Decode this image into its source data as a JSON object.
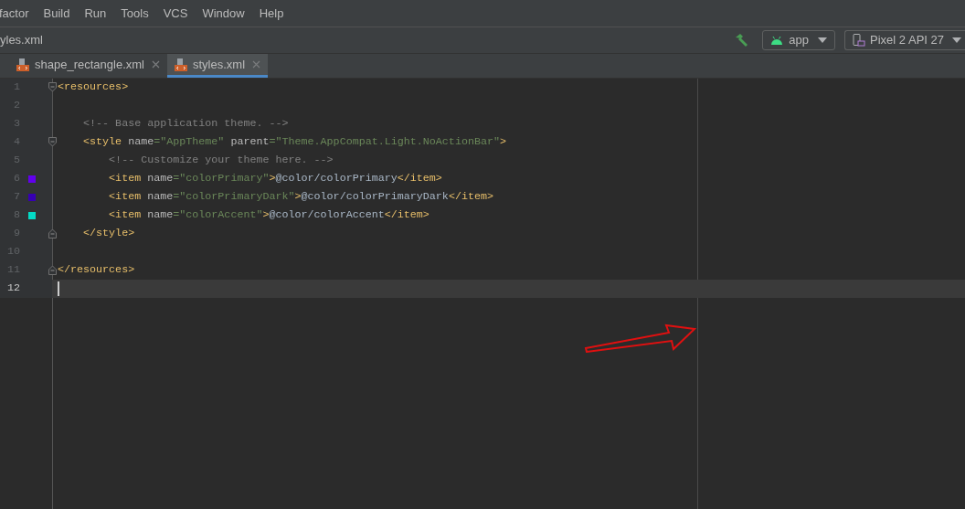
{
  "menu": [
    "factor",
    "Build",
    "Run",
    "Tools",
    "VCS",
    "Window",
    "Help"
  ],
  "breadcrumb": "yles.xml",
  "toolbar": {
    "config": "app",
    "device": "Pixel 2 API 27"
  },
  "tabs": [
    {
      "label": "shape_rectangle.xml",
      "selected": false
    },
    {
      "label": "styles.xml",
      "selected": true
    }
  ],
  "lines": [
    {
      "number": "1",
      "fold_start": true,
      "current": false,
      "tokens": [
        {
          "kind": "tag",
          "text": "<resources>"
        }
      ]
    },
    {
      "number": "2",
      "current": false
    },
    {
      "number": "3",
      "current": false,
      "tokens": [
        {
          "kind": "comment",
          "text": "    <!-- Base application theme. -->"
        }
      ]
    },
    {
      "number": "4",
      "fold_start": true,
      "current": false,
      "tokens": [
        {
          "kind": "tag",
          "text": "    <style "
        },
        {
          "kind": "attr",
          "text": "name"
        },
        {
          "kind": "value",
          "text": "=\"AppTheme\" "
        },
        {
          "kind": "attr",
          "text": "parent"
        },
        {
          "kind": "value",
          "text": "=\"Theme.AppCompat.Light.NoActionBar\""
        },
        {
          "kind": "tag",
          "text": ">"
        }
      ]
    },
    {
      "number": "5",
      "current": false,
      "tokens": [
        {
          "kind": "comment",
          "text": "        <!-- Customize your theme here. -->"
        }
      ]
    },
    {
      "number": "6",
      "color": "#6200ee",
      "current": false,
      "tokens": [
        {
          "kind": "tag",
          "text": "        <item "
        },
        {
          "kind": "attr",
          "text": "name"
        },
        {
          "kind": "value",
          "text": "=\"colorPrimary\""
        },
        {
          "kind": "tag",
          "text": ">"
        },
        {
          "kind": "text",
          "text": "@color/colorPrimary"
        },
        {
          "kind": "tag",
          "text": "</item>"
        }
      ]
    },
    {
      "number": "7",
      "color": "#3700b3",
      "current": false,
      "tokens": [
        {
          "kind": "tag",
          "text": "        <item "
        },
        {
          "kind": "attr",
          "text": "name"
        },
        {
          "kind": "value",
          "text": "=\"colorPrimaryDark\""
        },
        {
          "kind": "tag",
          "text": ">"
        },
        {
          "kind": "text",
          "text": "@color/colorPrimaryDark"
        },
        {
          "kind": "tag",
          "text": "</item>"
        }
      ]
    },
    {
      "number": "8",
      "color": "#03dac5",
      "current": false,
      "tokens": [
        {
          "kind": "tag",
          "text": "        <item "
        },
        {
          "kind": "attr",
          "text": "name"
        },
        {
          "kind": "value",
          "text": "=\"colorAccent\""
        },
        {
          "kind": "tag",
          "text": ">"
        },
        {
          "kind": "text",
          "text": "@color/colorAccent"
        },
        {
          "kind": "tag",
          "text": "</item>"
        }
      ]
    },
    {
      "number": "9",
      "fold_end": true,
      "current": false,
      "tokens": [
        {
          "kind": "tag",
          "text": "    </style>"
        }
      ]
    },
    {
      "number": "10",
      "current": false
    },
    {
      "number": "11",
      "fold_end": true,
      "current": false,
      "tokens": [
        {
          "kind": "tag",
          "text": "</resources>"
        }
      ]
    },
    {
      "number": "12",
      "current": true,
      "caret": true
    }
  ]
}
